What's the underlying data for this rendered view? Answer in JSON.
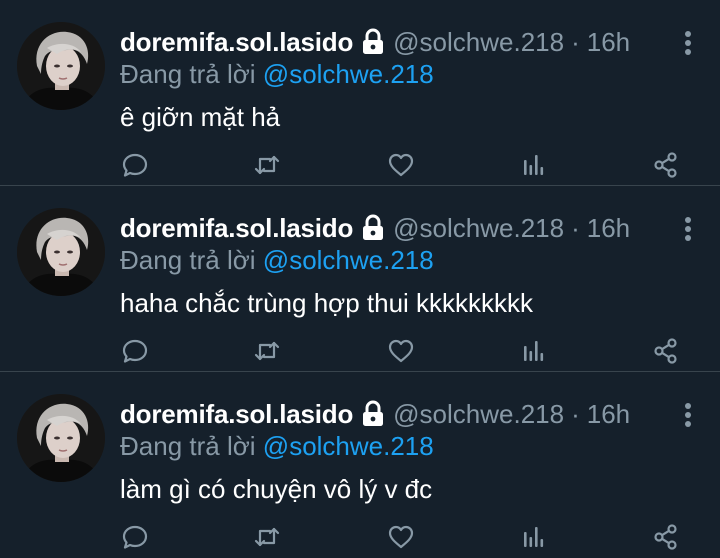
{
  "tweets": [
    {
      "name": "doremifa.sol.lasido",
      "handle": "@solchwe.218",
      "separator": "·",
      "time": "16h",
      "reply_prefix": "Đang trả lời",
      "reply_mention": "@solchwe.218",
      "text": "ê giỡn mặt hả"
    },
    {
      "name": "doremifa.sol.lasido",
      "handle": "@solchwe.218",
      "separator": "·",
      "time": "16h",
      "reply_prefix": "Đang trả lời",
      "reply_mention": "@solchwe.218",
      "text": "haha chắc trùng hợp thui kkkkkkkkk"
    },
    {
      "name": "doremifa.sol.lasido",
      "handle": "@solchwe.218",
      "separator": "·",
      "time": "16h",
      "reply_prefix": "Đang trả lời",
      "reply_mention": "@solchwe.218",
      "text": "làm gì có chuyện vô lý v đc"
    }
  ],
  "icons": {
    "lock": "lock-icon",
    "more": "more-vertical-icon",
    "reply": "reply-icon",
    "retweet": "retweet-icon",
    "like": "heart-icon",
    "stats": "analytics-icon",
    "share": "share-icon"
  },
  "colors": {
    "background": "#15202b",
    "text": "#ffffff",
    "muted": "#8899a6",
    "accent": "#1da1f2",
    "divider": "#38444d"
  }
}
